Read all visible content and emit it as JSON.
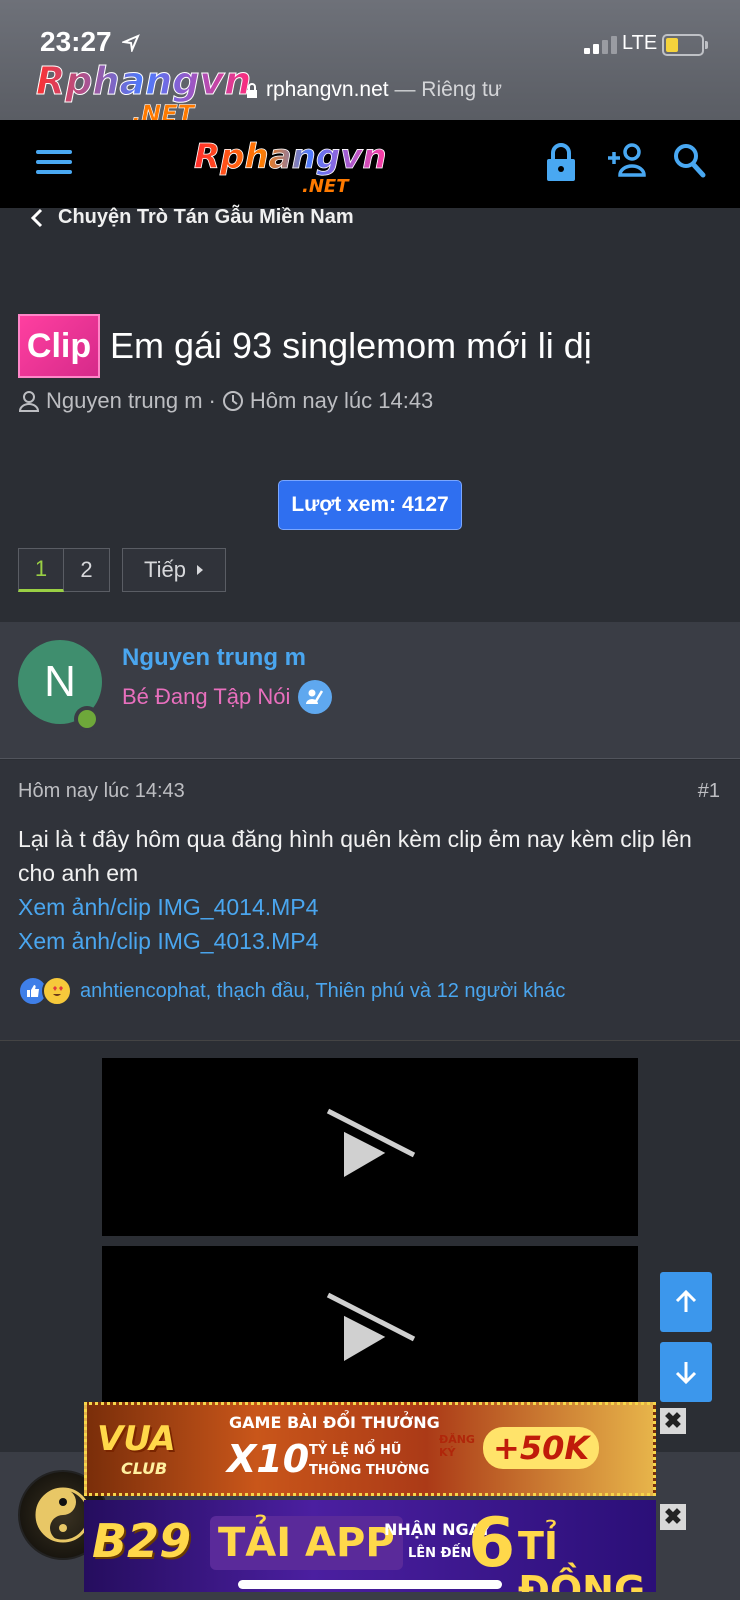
{
  "status": {
    "time": "23:27",
    "network": "LTE"
  },
  "browser": {
    "domain": "rphangvn.net",
    "privacy": "— Riêng tư"
  },
  "brand": {
    "name": "Rphangvn",
    "tld": ".NET"
  },
  "breadcrumb": "Chuyện Trò Tán Gẫu Miền Nam",
  "thread": {
    "prefix": "Clip",
    "title": "Em gái 93 singlemom mới li dị",
    "author": "Nguyen trung m",
    "separator": "·",
    "time": "Hôm nay lúc 14:43"
  },
  "views_label": "Lượt xem: 4127",
  "pagination": {
    "pages": [
      "1",
      "2"
    ],
    "next": "Tiếp"
  },
  "post": {
    "user": "Nguyen trung m",
    "avatar_letter": "N",
    "rank": "Bé Đang Tập Nói",
    "date": "Hôm nay lúc 14:43",
    "number": "#1",
    "text": "Lại là t đây hôm qua đăng hình quên kèm clip ẻm nay kèm clip lên cho anh em",
    "links": [
      "Xem ảnh/clip IMG_4014.MP4",
      "Xem ảnh/clip IMG_4013.MP4"
    ],
    "reactions": "anhtiencophat, thạch đầu, Thiên phú và 12 người khác"
  },
  "ads": {
    "ad1": {
      "brand": "VUA",
      "sub": "CLUB",
      "line1": "GAME BÀI ĐỔI THƯỞNG",
      "x10": "X10",
      "rate1": "TỶ LỆ NỔ HŨ",
      "rate2": "THÔNG THƯỜNG",
      "signup": "ĐĂNG KÝ",
      "bonus": "+50K"
    },
    "ad2": {
      "brand": "B29",
      "cta": "TẢI APP",
      "line1": "NHẬN NGAY",
      "line2": "LÊN ĐẾN",
      "amount": "6",
      "unit": "TỈ ĐỒNG"
    },
    "close": "✖"
  },
  "colors": {
    "accent": "#4aa6ef",
    "views_button": "#2f6ff0",
    "rank": "#e86fbd",
    "online": "#6ea83a"
  }
}
